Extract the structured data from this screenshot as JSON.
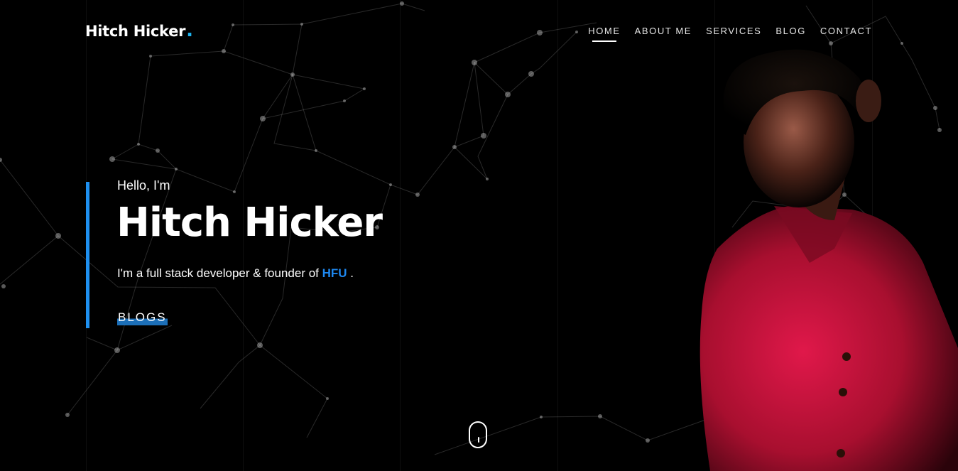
{
  "header": {
    "logo_text": "Hitch Hicker",
    "logo_dot": ".",
    "nav": [
      {
        "label": "HOME",
        "active": true
      },
      {
        "label": "ABOUT ME",
        "active": false
      },
      {
        "label": "SERVICES",
        "active": false
      },
      {
        "label": "BLOG",
        "active": false
      },
      {
        "label": "CONTACT",
        "active": false
      }
    ]
  },
  "hero": {
    "greeting": "Hello, I'm",
    "name": "Hitch Hicker",
    "tagline_prefix": "I'm a full stack developer & founder of ",
    "tagline_brand": "HFU",
    "tagline_suffix": " .",
    "cta_label": "BLOGS"
  },
  "scroll_indicator": {
    "icon": "mouse-scroll-icon"
  },
  "colors": {
    "accent": "#1e90f0",
    "logo_dot": "#1eb4f0",
    "background": "#000000",
    "shirt": "#c8143c"
  }
}
